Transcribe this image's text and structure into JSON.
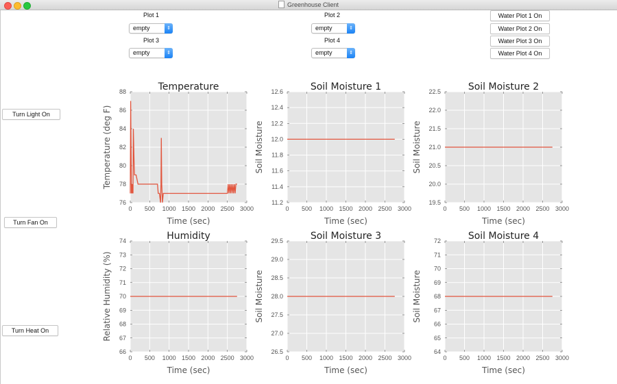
{
  "window": {
    "title": "Greenhouse Client"
  },
  "plots": [
    {
      "label": "Plot 1",
      "selected": "empty"
    },
    {
      "label": "Plot 2",
      "selected": "empty"
    },
    {
      "label": "Plot 3",
      "selected": "empty"
    },
    {
      "label": "Plot 4",
      "selected": "empty"
    }
  ],
  "water_buttons": [
    "Water Plot 1 On",
    "Water Plot 2 On",
    "Water Plot 3 On",
    "Water Plot 4 On"
  ],
  "controls": {
    "light": "Turn Light On",
    "fan": "Turn Fan On",
    "heat": "Turn Heat On"
  },
  "colors": {
    "line": "#e2553d",
    "plot_bg": "#e5e5e5",
    "grid": "#ffffff"
  },
  "chart_data": [
    {
      "type": "line",
      "title": "Temperature",
      "xlabel": "Time (sec)",
      "ylabel": "Temperature (deg F)",
      "xlim": [
        0,
        3000
      ],
      "ylim": [
        76,
        88
      ],
      "xticks": [
        0,
        500,
        1000,
        1500,
        2000,
        2500,
        3000
      ],
      "xtick_labels": [
        "0",
        "500",
        "1000",
        "1500",
        "2000",
        "2500",
        "3000"
      ],
      "yticks": [
        76,
        78,
        80,
        82,
        84,
        86,
        88
      ],
      "ytick_labels": [
        "76",
        "78",
        "80",
        "82",
        "84",
        "86",
        "88"
      ],
      "series": [
        {
          "x": [
            0,
            10,
            30,
            40,
            50,
            60,
            70,
            80,
            90,
            100,
            110,
            150,
            200,
            250,
            300,
            350,
            400,
            700,
            720,
            750,
            780,
            790,
            800,
            810,
            830,
            850,
            900,
            2500,
            2520,
            2540,
            2560,
            2580,
            2600,
            2620,
            2640,
            2660,
            2680,
            2700,
            2720,
            2750
          ],
          "y": [
            77,
            87,
            77,
            78,
            77,
            78,
            77,
            84,
            82,
            80,
            79,
            79,
            78,
            78,
            78,
            78,
            78,
            78,
            77,
            77,
            76,
            78,
            83,
            78,
            76,
            77,
            77,
            77,
            78,
            77,
            78,
            77,
            78,
            77,
            78,
            77,
            78,
            77,
            78,
            78
          ]
        }
      ]
    },
    {
      "type": "line",
      "title": "Soil Moisture 1",
      "xlabel": "Time (sec)",
      "ylabel": "Soil Moisture",
      "xlim": [
        0,
        3000
      ],
      "ylim": [
        11.2,
        12.6
      ],
      "xticks": [
        0,
        500,
        1000,
        1500,
        2000,
        2500,
        3000
      ],
      "xtick_labels": [
        "0",
        "500",
        "1000",
        "1500",
        "2000",
        "2500",
        "3000"
      ],
      "yticks": [
        11.2,
        11.4,
        11.6,
        11.8,
        12.0,
        12.2,
        12.4,
        12.6
      ],
      "ytick_labels": [
        "11.2",
        "11.4",
        "11.6",
        "11.8",
        "12.0",
        "12.2",
        "12.4",
        "12.6"
      ],
      "series": [
        {
          "x": [
            0,
            2750
          ],
          "y": [
            12.0,
            12.0
          ]
        }
      ]
    },
    {
      "type": "line",
      "title": "Soil Moisture 2",
      "xlabel": "Time (sec)",
      "ylabel": "Soil Moisture",
      "xlim": [
        0,
        3000
      ],
      "ylim": [
        19.5,
        22.5
      ],
      "xticks": [
        0,
        500,
        1000,
        1500,
        2000,
        2500,
        3000
      ],
      "xtick_labels": [
        "0",
        "500",
        "1000",
        "1500",
        "2000",
        "2500",
        "3000"
      ],
      "yticks": [
        19.5,
        20.0,
        20.5,
        21.0,
        21.5,
        22.0,
        22.5
      ],
      "ytick_labels": [
        "19.5",
        "20.0",
        "20.5",
        "21.0",
        "21.5",
        "22.0",
        "22.5"
      ],
      "series": [
        {
          "x": [
            0,
            2750
          ],
          "y": [
            21.0,
            21.0
          ]
        }
      ]
    },
    {
      "type": "line",
      "title": "Humidity",
      "xlabel": "Time (sec)",
      "ylabel": "Relative Humidity (%)",
      "xlim": [
        0,
        3000
      ],
      "ylim": [
        66,
        74
      ],
      "xticks": [
        0,
        500,
        1000,
        1500,
        2000,
        2500,
        3000
      ],
      "xtick_labels": [
        "0",
        "500",
        "1000",
        "1500",
        "2000",
        "2500",
        "3000"
      ],
      "yticks": [
        66,
        67,
        68,
        69,
        70,
        71,
        72,
        73,
        74
      ],
      "ytick_labels": [
        "66",
        "67",
        "68",
        "69",
        "70",
        "71",
        "72",
        "73",
        "74"
      ],
      "series": [
        {
          "x": [
            0,
            2750
          ],
          "y": [
            70,
            70
          ]
        }
      ]
    },
    {
      "type": "line",
      "title": "Soil Moisture 3",
      "xlabel": "Time (sec)",
      "ylabel": "Soil Moisture",
      "xlim": [
        0,
        3000
      ],
      "ylim": [
        26.5,
        29.5
      ],
      "xticks": [
        0,
        500,
        1000,
        1500,
        2000,
        2500,
        3000
      ],
      "xtick_labels": [
        "0",
        "500",
        "1000",
        "1500",
        "2000",
        "2500",
        "3000"
      ],
      "yticks": [
        26.5,
        27.0,
        27.5,
        28.0,
        28.5,
        29.0,
        29.5
      ],
      "ytick_labels": [
        "26.5",
        "27.0",
        "27.5",
        "28.0",
        "28.5",
        "29.0",
        "29.5"
      ],
      "series": [
        {
          "x": [
            0,
            2750
          ],
          "y": [
            28.0,
            28.0
          ]
        }
      ]
    },
    {
      "type": "line",
      "title": "Soil Moisture 4",
      "xlabel": "Time (sec)",
      "ylabel": "Soil Moisture",
      "xlim": [
        0,
        3000
      ],
      "ylim": [
        64,
        72
      ],
      "xticks": [
        0,
        500,
        1000,
        1500,
        2000,
        2500,
        3000
      ],
      "xtick_labels": [
        "0",
        "500",
        "1000",
        "1500",
        "2000",
        "2500",
        "3000"
      ],
      "yticks": [
        64,
        65,
        66,
        67,
        68,
        69,
        70,
        71,
        72
      ],
      "ytick_labels": [
        "64",
        "65",
        "66",
        "67",
        "68",
        "69",
        "70",
        "71",
        "72"
      ],
      "series": [
        {
          "x": [
            0,
            2750
          ],
          "y": [
            68,
            68
          ]
        }
      ]
    }
  ]
}
